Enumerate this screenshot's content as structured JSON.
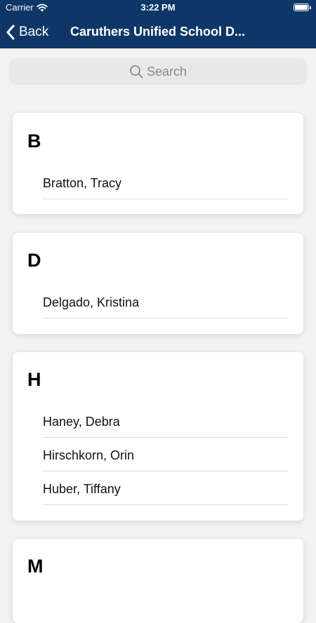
{
  "status_bar": {
    "carrier": "Carrier",
    "time": "3:22 PM"
  },
  "nav": {
    "back_label": "Back",
    "title": "Caruthers Unified School D..."
  },
  "search": {
    "placeholder": "Search"
  },
  "sections": [
    {
      "letter": "B",
      "items": [
        "Bratton, Tracy"
      ]
    },
    {
      "letter": "D",
      "items": [
        "Delgado, Kristina"
      ]
    },
    {
      "letter": "H",
      "items": [
        "Haney, Debra",
        "Hirschkorn, Orin",
        "Huber, Tiffany"
      ]
    },
    {
      "letter": "M",
      "items": []
    }
  ],
  "colors": {
    "nav_background": "#0e3768",
    "page_background": "#f2f2f2",
    "search_background": "#e8e8e8"
  }
}
